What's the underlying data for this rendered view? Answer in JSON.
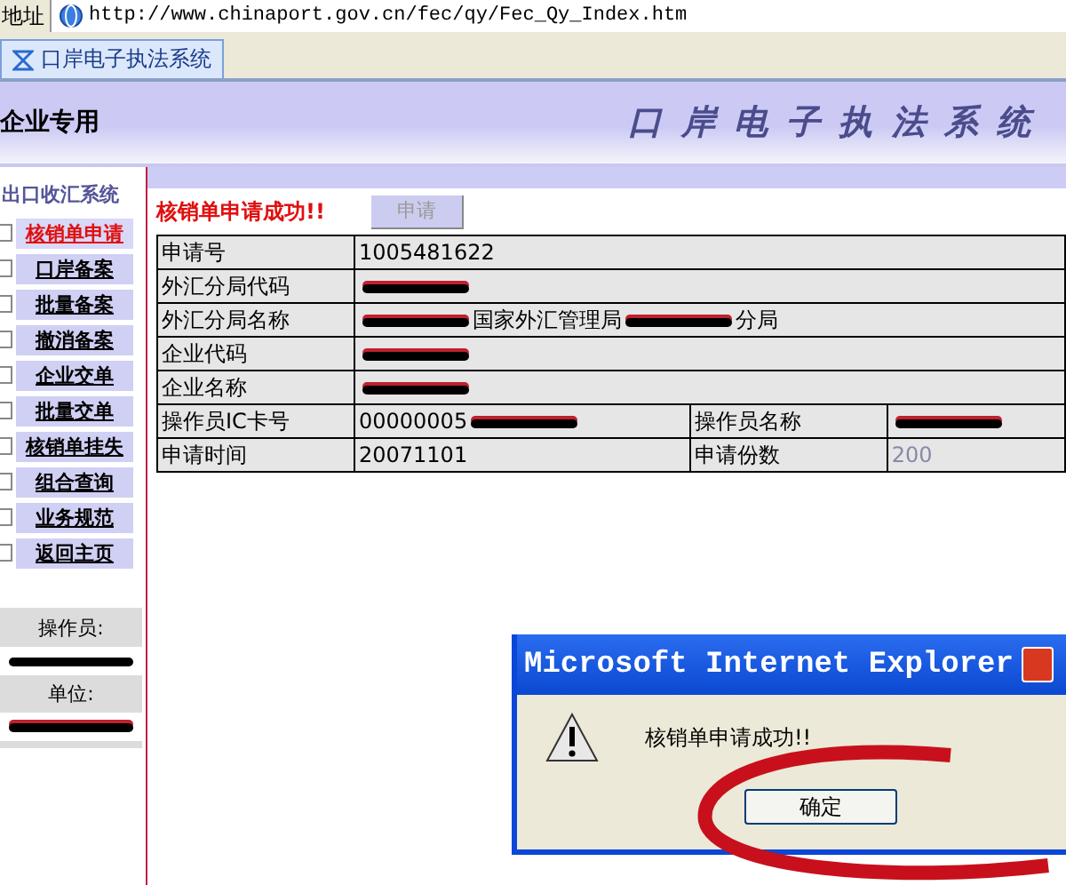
{
  "address_bar": {
    "label": "地址",
    "url": "http://www.chinaport.gov.cn/fec/qy/Fec_Qy_Index.htm"
  },
  "tabs": [
    {
      "label": "口岸电子执法系统",
      "selected": true
    }
  ],
  "header": {
    "left": "企业专用",
    "title": "口 岸 电 子 执 法 系 统"
  },
  "sidebar": {
    "title": "出口收汇系统",
    "items": [
      {
        "label": "核销单申请",
        "selected": true
      },
      {
        "label": "口岸备案",
        "selected": false
      },
      {
        "label": "批量备案",
        "selected": false
      },
      {
        "label": "撤消备案",
        "selected": false
      },
      {
        "label": "企业交单",
        "selected": false
      },
      {
        "label": "批量交单",
        "selected": false
      },
      {
        "label": "核销单挂失",
        "selected": false
      },
      {
        "label": "组合查询",
        "selected": false
      },
      {
        "label": "业务规范",
        "selected": false
      },
      {
        "label": "返回主页",
        "selected": false
      }
    ],
    "operator_label": "操作员:",
    "unit_label": "单位:"
  },
  "main": {
    "message": "核销单申请成功!!",
    "button": {
      "label": "申请",
      "disabled": true
    },
    "rows": [
      {
        "cells": [
          {
            "kind": "label",
            "parts": [
              {
                "kind": "text",
                "text": "申请号"
              }
            ]
          },
          {
            "kind": "value",
            "colspan": 3,
            "parts": [
              {
                "kind": "text",
                "text": "1005481622"
              }
            ]
          }
        ]
      },
      {
        "cells": [
          {
            "kind": "label",
            "parts": [
              {
                "kind": "text",
                "text": "外汇分局代码"
              }
            ]
          },
          {
            "kind": "value",
            "colspan": 3,
            "parts": [
              {
                "kind": "redacted"
              }
            ]
          }
        ]
      },
      {
        "cells": [
          {
            "kind": "label",
            "parts": [
              {
                "kind": "text",
                "text": "外汇分局名称"
              }
            ]
          },
          {
            "kind": "value",
            "colspan": 3,
            "parts": [
              {
                "kind": "redacted"
              },
              {
                "kind": "text",
                "text": "国家外汇管理局"
              },
              {
                "kind": "redacted"
              },
              {
                "kind": "text",
                "text": "分局"
              }
            ]
          }
        ]
      },
      {
        "cells": [
          {
            "kind": "label",
            "parts": [
              {
                "kind": "text",
                "text": "企业代码"
              }
            ]
          },
          {
            "kind": "value",
            "colspan": 3,
            "parts": [
              {
                "kind": "redacted"
              }
            ]
          }
        ]
      },
      {
        "cells": [
          {
            "kind": "label",
            "parts": [
              {
                "kind": "text",
                "text": "企业名称"
              }
            ]
          },
          {
            "kind": "value",
            "colspan": 3,
            "parts": [
              {
                "kind": "redacted"
              }
            ]
          }
        ]
      },
      {
        "cells": [
          {
            "kind": "label",
            "parts": [
              {
                "kind": "text",
                "text": "操作员IC卡号"
              }
            ]
          },
          {
            "kind": "value",
            "parts": [
              {
                "kind": "text",
                "text": "00000005"
              },
              {
                "kind": "redacted"
              }
            ]
          },
          {
            "kind": "label",
            "parts": [
              {
                "kind": "text",
                "text": "操作员名称"
              }
            ]
          },
          {
            "kind": "value",
            "parts": [
              {
                "kind": "redacted"
              }
            ]
          }
        ]
      },
      {
        "cells": [
          {
            "kind": "label",
            "parts": [
              {
                "kind": "text",
                "text": "申请时间"
              }
            ]
          },
          {
            "kind": "value",
            "parts": [
              {
                "kind": "text",
                "text": "20071101"
              }
            ]
          },
          {
            "kind": "label",
            "parts": [
              {
                "kind": "text",
                "text": "申请份数"
              }
            ]
          },
          {
            "kind": "muted",
            "parts": [
              {
                "kind": "text",
                "text": "200"
              }
            ]
          }
        ]
      }
    ]
  },
  "dialog": {
    "title": "Microsoft Internet Explorer",
    "message": "核销单申请成功!!",
    "button": "确定",
    "circled": true
  }
}
